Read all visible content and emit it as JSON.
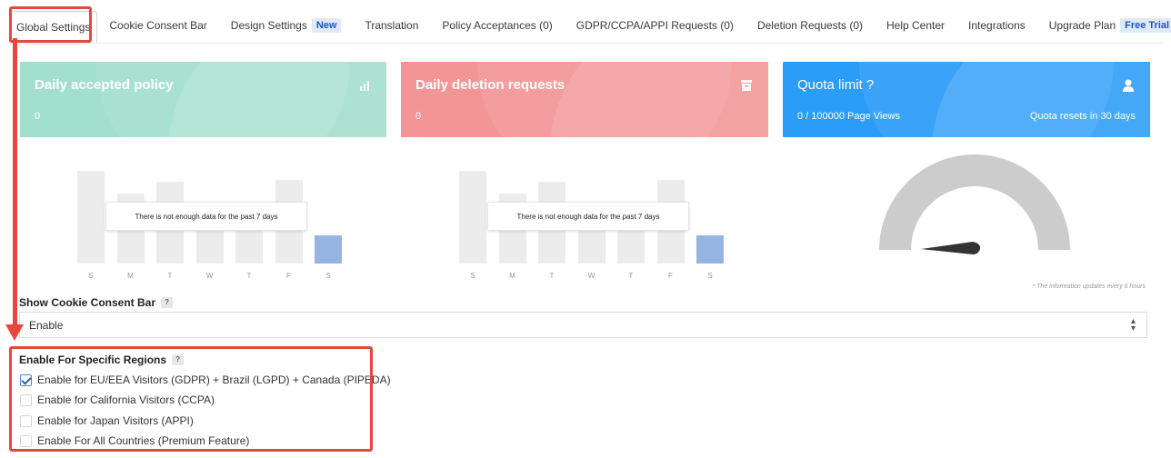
{
  "tabs": [
    {
      "label": "Global Settings",
      "active": true
    },
    {
      "label": "Cookie Consent Bar"
    },
    {
      "label": "Design Settings",
      "badge": "New"
    },
    {
      "label": "Translation"
    },
    {
      "label": "Policy Acceptances (0)"
    },
    {
      "label": "GDPR/CCPA/APPI Requests (0)"
    },
    {
      "label": "Deletion Requests (0)"
    },
    {
      "label": "Help Center"
    },
    {
      "label": "Integrations"
    },
    {
      "label": "Upgrade Plan",
      "badge": "Free Trial"
    }
  ],
  "cards": {
    "accepted": {
      "title": "Daily accepted policy",
      "value": "0",
      "icon": "bar-chart-icon",
      "color": "#a2dfcd"
    },
    "deletion": {
      "title": "Daily deletion requests",
      "value": "0",
      "icon": "archive-icon",
      "color": "#f39596"
    },
    "quota": {
      "title": "Quota limit ?",
      "value": "0 / 100000 Page Views",
      "reset": "Quota resets in 30 days",
      "icon": "user-icon",
      "color": "#2b9cf7"
    }
  },
  "charts": {
    "days": [
      "S",
      "M",
      "T",
      "W",
      "T",
      "F",
      "S"
    ],
    "no_data_text": "There is not enough data for the past 7 days",
    "placeholder_heights": [
      0.82,
      0.62,
      0.72,
      0.52,
      0.5,
      0.74,
      0.25
    ],
    "highlight_index": 6
  },
  "gauge": {
    "note": "* The information updates every 6 hours",
    "value": 0
  },
  "show_bar": {
    "label": "Show Cookie Consent Bar",
    "help": "?",
    "selected": "Enable"
  },
  "regions": {
    "label": "Enable For Specific Regions",
    "help": "?",
    "options": [
      {
        "label": "Enable for EU/EEA Visitors (GDPR) + Brazil (LGPD) + Canada (PIPEDA)",
        "checked": true
      },
      {
        "label": "Enable for California Visitors (CCPA)",
        "checked": false
      },
      {
        "label": "Enable for Japan Visitors (APPI)",
        "checked": false
      },
      {
        "label": "Enable For All Countries (Premium Feature)",
        "checked": false
      }
    ]
  }
}
